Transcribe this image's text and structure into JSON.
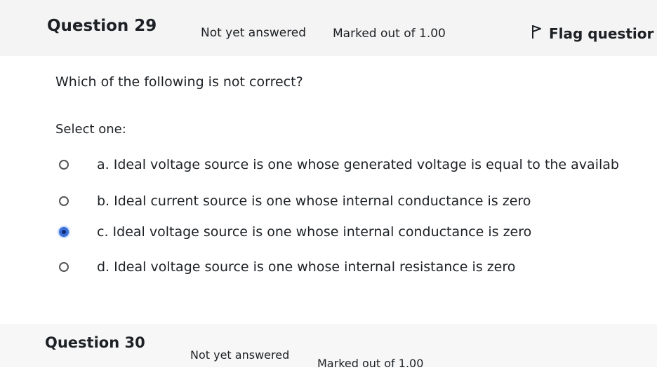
{
  "question": {
    "number_label": "Question 29",
    "status": "Not yet answered",
    "marked": "Marked out of 1.00",
    "flag_label": "Flag questior",
    "text": "Which of the following is not correct?",
    "select_one": "Select one:",
    "options": [
      {
        "label": "a. Ideal voltage source is one whose generated voltage is equal to the availab",
        "selected": false
      },
      {
        "label": "b. Ideal current source is one whose internal conductance is zero",
        "selected": false
      },
      {
        "label": "c. Ideal voltage source is one whose internal conductance is zero",
        "selected": true
      },
      {
        "label": "d. Ideal voltage source is one whose internal resistance is zero",
        "selected": false
      }
    ]
  },
  "next_question": {
    "number_label": "Question 30",
    "status": "Not yet answered",
    "marked": "Marked out of 1.00"
  },
  "colors": {
    "radio_selected": "#3a6fd6",
    "header_background": "#f4f4f4"
  }
}
